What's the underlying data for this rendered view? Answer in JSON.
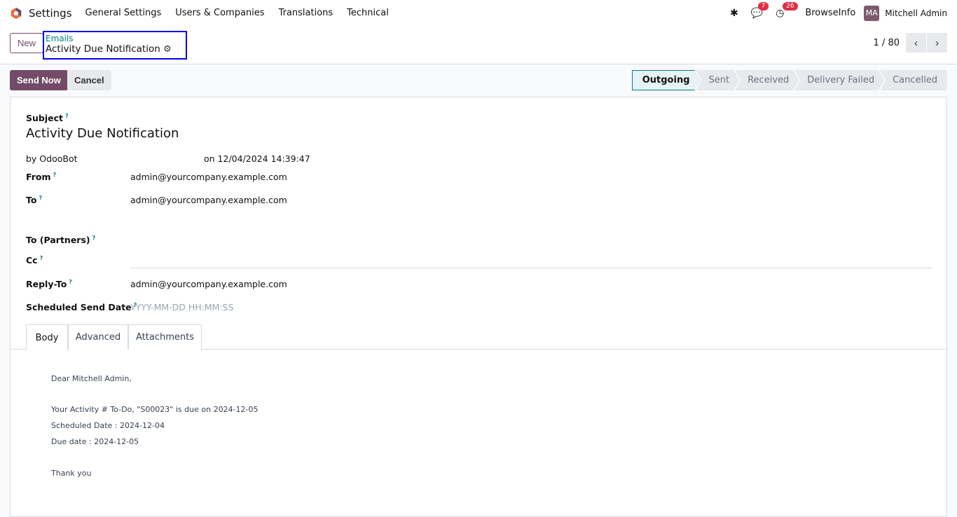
{
  "nav": {
    "app": "Settings",
    "menus": [
      "General Settings",
      "Users & Companies",
      "Translations",
      "Technical"
    ],
    "messages_badge": "7",
    "activities_badge": "26",
    "company": "BrowseInfo",
    "user": "Mitchell Admin",
    "user_initials": "MA"
  },
  "control": {
    "new_label": "New",
    "breadcrumb_parent": "Emails",
    "breadcrumb_current": "Activity Due Notification",
    "pager": "1 / 80"
  },
  "actions": {
    "send_now": "Send Now",
    "cancel": "Cancel"
  },
  "statusbar": [
    "Outgoing",
    "Sent",
    "Received",
    "Delivery Failed",
    "Cancelled"
  ],
  "form": {
    "subject_label": "Subject",
    "subject": "Activity Due Notification",
    "author": "by OdooBot",
    "date": "on 12/04/2024 14:39:47",
    "from_label": "From",
    "from": "admin@yourcompany.example.com",
    "to_label": "To",
    "to": "admin@yourcompany.example.com",
    "to_partners_label": "To (Partners)",
    "cc_label": "Cc",
    "reply_to_label": "Reply-To",
    "reply_to": "admin@yourcompany.example.com",
    "scheduled_label": "Scheduled Send Date",
    "scheduled_placeholder": "YYYY-MM-DD HH:MM:SS",
    "help": "?"
  },
  "tabs": [
    "Body",
    "Advanced",
    "Attachments"
  ],
  "body": [
    "Dear Mitchell Admin,",
    "Your Activity # To-Do, \"S00023\" is due on 2024-12-05",
    "Scheduled Date : 2024-12-04",
    "Due date : 2024-12-05",
    "Thank you"
  ]
}
